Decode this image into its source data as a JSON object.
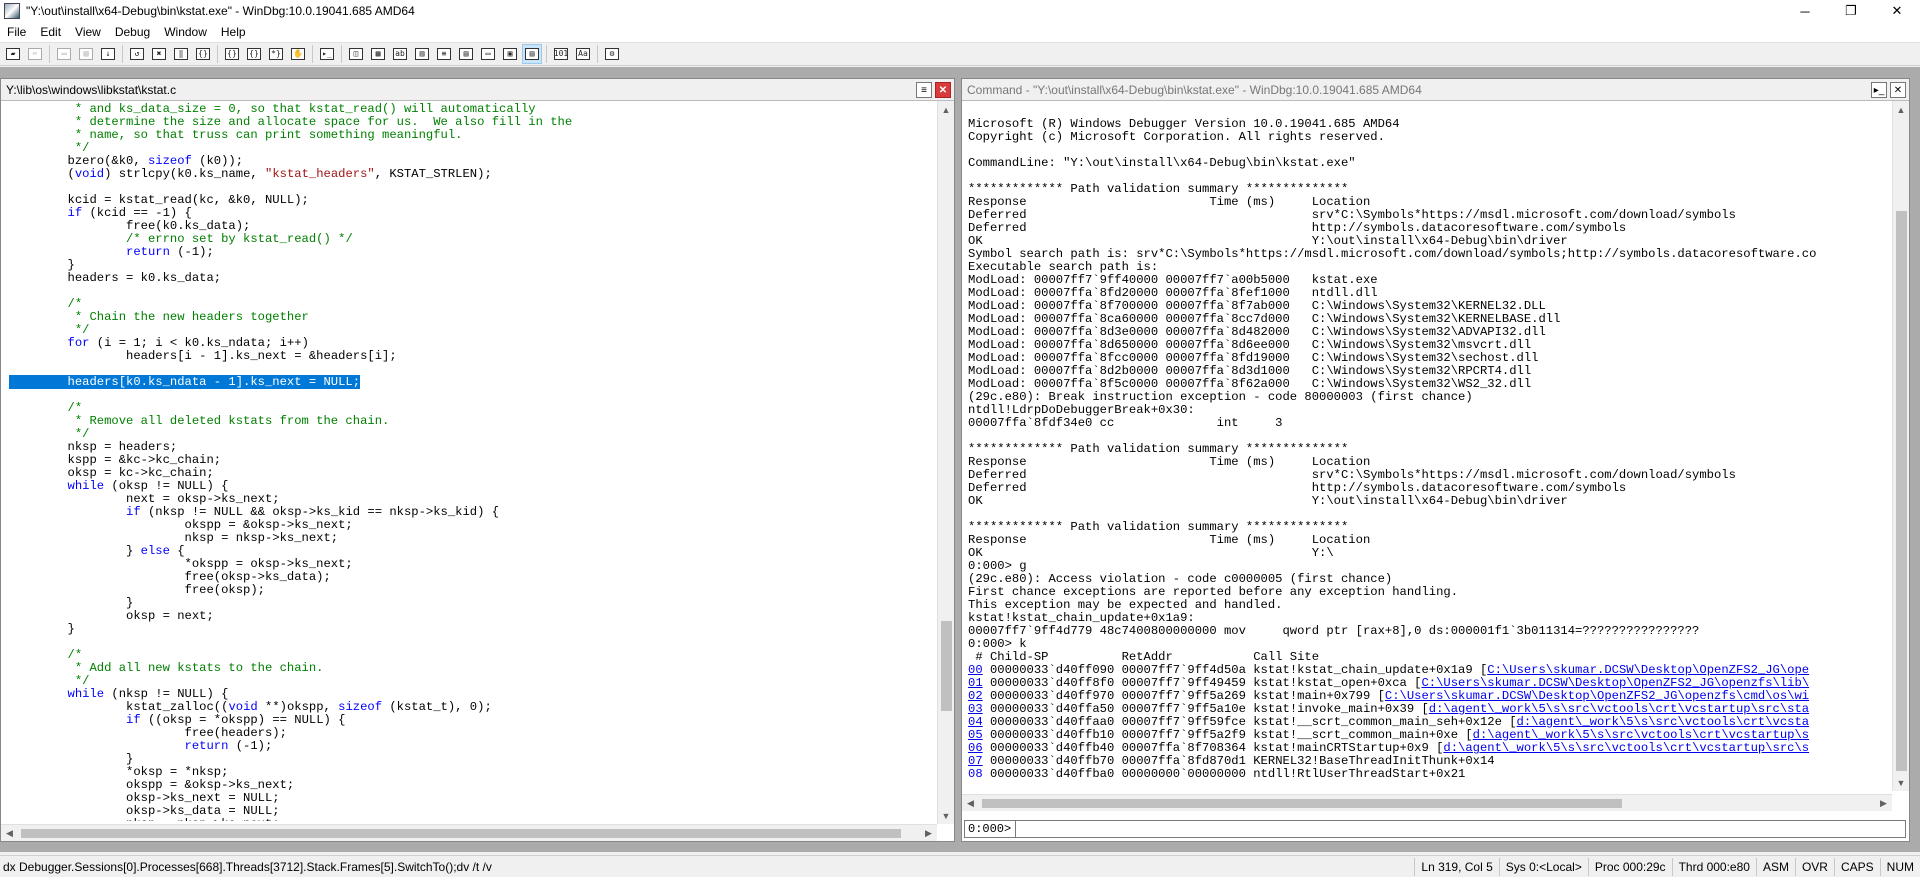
{
  "window": {
    "title": "\"Y:\\out\\install\\x64-Debug\\bin\\kstat.exe\" - WinDbg:10.0.19041.685 AMD64",
    "minimize_glyph": "─",
    "maximize_glyph": "❐",
    "close_glyph": "✕"
  },
  "menu": [
    "File",
    "Edit",
    "View",
    "Debug",
    "Window",
    "Help"
  ],
  "toolbar": [
    {
      "icon": "open-folder-icon",
      "glyph": "▰",
      "enabled": true
    },
    {
      "icon": "cut-icon",
      "glyph": "✂",
      "enabled": false
    },
    {
      "icon": "copy-icon",
      "glyph": "▭",
      "enabled": false
    },
    {
      "icon": "paste-icon",
      "glyph": "▤",
      "enabled": false
    },
    {
      "icon": "go-icon",
      "glyph": "↓",
      "enabled": true
    },
    {
      "icon": "restart-icon",
      "glyph": "↺",
      "enabled": true
    },
    {
      "icon": "stop-debugging-icon",
      "glyph": "✖",
      "enabled": true
    },
    {
      "icon": "break-icon",
      "glyph": "‖",
      "enabled": true
    },
    {
      "icon": "step-into-icon",
      "glyph": "{}",
      "enabled": true
    },
    {
      "icon": "step-over-icon",
      "glyph": "{}",
      "enabled": true
    },
    {
      "icon": "step-out-icon",
      "glyph": "{}",
      "enabled": true
    },
    {
      "icon": "run-to-cursor-icon",
      "glyph": "*}",
      "enabled": true
    },
    {
      "icon": "insert-breakpoint-icon",
      "glyph": "✋",
      "enabled": true
    },
    {
      "icon": "command-window-icon",
      "glyph": "▸_",
      "enabled": true
    },
    {
      "icon": "watch-window-icon",
      "glyph": "◫",
      "enabled": true
    },
    {
      "icon": "locals-window-icon",
      "glyph": "▦",
      "enabled": true
    },
    {
      "icon": "registers-window-icon",
      "glyph": "ab",
      "enabled": true
    },
    {
      "icon": "memory-window-icon",
      "glyph": "▥",
      "enabled": true
    },
    {
      "icon": "call-stack-window-icon",
      "glyph": "≡",
      "enabled": true
    },
    {
      "icon": "disassembly-window-icon",
      "glyph": "▤",
      "enabled": true
    },
    {
      "icon": "scratch-pad-icon",
      "glyph": "▭",
      "enabled": true
    },
    {
      "icon": "processes-threads-icon",
      "glyph": "▣",
      "enabled": true
    },
    {
      "icon": "source-mode-icon",
      "glyph": "▤",
      "enabled": true,
      "active": true
    },
    {
      "icon": "hex-mode-icon",
      "glyph": "101",
      "enabled": true
    },
    {
      "icon": "font-icon",
      "glyph": "Aa",
      "enabled": true
    },
    {
      "icon": "options-icon",
      "glyph": "⚙",
      "enabled": true
    }
  ],
  "source": {
    "title": "Y:\\lib\\os\\windows\\libkstat\\kstat.c",
    "lines": [
      [
        [
          "c",
          "\t * and ks_data_size = 0, so that kstat_read() will automatically"
        ]
      ],
      [
        [
          "c",
          "\t * determine the size and allocate space for us.  We also fill in the"
        ]
      ],
      [
        [
          "c",
          "\t * name, so that truss can print something meaningful."
        ]
      ],
      [
        [
          "c",
          "\t */"
        ]
      ],
      [
        [
          "t",
          "\tbzero(&k0, "
        ],
        [
          "k",
          "sizeof"
        ],
        [
          "t",
          " (k0));"
        ]
      ],
      [
        [
          "t",
          "\t("
        ],
        [
          "k",
          "void"
        ],
        [
          "t",
          ") strlcpy(k0.ks_name, "
        ],
        [
          "s",
          "\"kstat_headers\""
        ],
        [
          "t",
          ", KSTAT_STRLEN);"
        ]
      ],
      [
        [
          "t",
          ""
        ]
      ],
      [
        [
          "t",
          "\tkcid = kstat_read(kc, &k0, NULL);"
        ]
      ],
      [
        [
          "k",
          "\tif"
        ],
        [
          "t",
          " (kcid == -1) {"
        ]
      ],
      [
        [
          "t",
          "\t\tfree(k0.ks_data);"
        ]
      ],
      [
        [
          "c",
          "\t\t/* errno set by kstat_read() */"
        ]
      ],
      [
        [
          "k",
          "\t\treturn"
        ],
        [
          "t",
          " (-1);"
        ]
      ],
      [
        [
          "t",
          "\t}"
        ]
      ],
      [
        [
          "t",
          "\theaders = k0.ks_data;"
        ]
      ],
      [
        [
          "t",
          ""
        ]
      ],
      [
        [
          "c",
          "\t/*"
        ]
      ],
      [
        [
          "c",
          "\t * Chain the new headers together"
        ]
      ],
      [
        [
          "c",
          "\t */"
        ]
      ],
      [
        [
          "k",
          "\tfor"
        ],
        [
          "t",
          " (i = 1; i < k0.ks_ndata; i++)"
        ]
      ],
      [
        [
          "t",
          "\t\theaders[i - 1].ks_next = &headers[i];"
        ]
      ],
      [
        [
          "t",
          ""
        ]
      ],
      [
        [
          "hl",
          "\theaders[k0.ks_ndata - 1].ks_next = NULL;"
        ]
      ],
      [
        [
          "t",
          ""
        ]
      ],
      [
        [
          "c",
          "\t/*"
        ]
      ],
      [
        [
          "c",
          "\t * Remove all deleted kstats from the chain."
        ]
      ],
      [
        [
          "c",
          "\t */"
        ]
      ],
      [
        [
          "t",
          "\tnksp = headers;"
        ]
      ],
      [
        [
          "t",
          "\tkspp = &kc->kc_chain;"
        ]
      ],
      [
        [
          "t",
          "\toksp = kc->kc_chain;"
        ]
      ],
      [
        [
          "k",
          "\twhile"
        ],
        [
          "t",
          " (oksp != NULL) {"
        ]
      ],
      [
        [
          "t",
          "\t\tnext = oksp->ks_next;"
        ]
      ],
      [
        [
          "k",
          "\t\tif"
        ],
        [
          "t",
          " (nksp != NULL && oksp->ks_kid == nksp->ks_kid) {"
        ]
      ],
      [
        [
          "t",
          "\t\t\tokspp = &oksp->ks_next;"
        ]
      ],
      [
        [
          "t",
          "\t\t\tnksp = nksp->ks_next;"
        ]
      ],
      [
        [
          "t",
          "\t\t} "
        ],
        [
          "k",
          "else"
        ],
        [
          "t",
          " {"
        ]
      ],
      [
        [
          "t",
          "\t\t\t*okspp = oksp->ks_next;"
        ]
      ],
      [
        [
          "t",
          "\t\t\tfree(oksp->ks_data);"
        ]
      ],
      [
        [
          "t",
          "\t\t\tfree(oksp);"
        ]
      ],
      [
        [
          "t",
          "\t\t}"
        ]
      ],
      [
        [
          "t",
          "\t\toksp = next;"
        ]
      ],
      [
        [
          "t",
          "\t}"
        ]
      ],
      [
        [
          "t",
          ""
        ]
      ],
      [
        [
          "c",
          "\t/*"
        ]
      ],
      [
        [
          "c",
          "\t * Add all new kstats to the chain."
        ]
      ],
      [
        [
          "c",
          "\t */"
        ]
      ],
      [
        [
          "k",
          "\twhile"
        ],
        [
          "t",
          " (nksp != NULL) {"
        ]
      ],
      [
        [
          "t",
          "\t\tkstat_zalloc(("
        ],
        [
          "k",
          "void"
        ],
        [
          "t",
          " **)okspp, "
        ],
        [
          "k",
          "sizeof"
        ],
        [
          "t",
          " (kstat_t), 0);"
        ]
      ],
      [
        [
          "k",
          "\t\tif"
        ],
        [
          "t",
          " ((oksp = *okspp) == NULL) {"
        ]
      ],
      [
        [
          "t",
          "\t\t\tfree(headers);"
        ]
      ],
      [
        [
          "k",
          "\t\t\treturn"
        ],
        [
          "t",
          " (-1);"
        ]
      ],
      [
        [
          "t",
          "\t\t}"
        ]
      ],
      [
        [
          "t",
          "\t\t*oksp = *nksp;"
        ]
      ],
      [
        [
          "t",
          "\t\tokspp = &oksp->ks_next;"
        ]
      ],
      [
        [
          "t",
          "\t\toksp->ks_next = NULL;"
        ]
      ],
      [
        [
          "t",
          "\t\toksp->ks_data = NULL;"
        ]
      ],
      [
        [
          "t",
          "\t\tnksp = nksp->ks_next;"
        ]
      ],
      [
        [
          "t",
          "\t}"
        ]
      ]
    ]
  },
  "command": {
    "title": "Command - \"Y:\\out\\install\\x64-Debug\\bin\\kstat.exe\" - WinDbg:10.0.19041.685 AMD64",
    "prompt": "0:000>",
    "input_value": "",
    "lines": [
      [
        [
          "t",
          ""
        ]
      ],
      [
        [
          "t",
          "Microsoft (R) Windows Debugger Version 10.0.19041.685 AMD64"
        ]
      ],
      [
        [
          "t",
          "Copyright (c) Microsoft Corporation. All rights reserved."
        ]
      ],
      [
        [
          "t",
          ""
        ]
      ],
      [
        [
          "t",
          "CommandLine: \"Y:\\out\\install\\x64-Debug\\bin\\kstat.exe\""
        ]
      ],
      [
        [
          "t",
          ""
        ]
      ],
      [
        [
          "t",
          "************* Path validation summary **************"
        ]
      ],
      [
        [
          "t",
          "Response                         Time (ms)     Location"
        ]
      ],
      [
        [
          "t",
          "Deferred                                       srv*C:\\Symbols*https://msdl.microsoft.com/download/symbols"
        ]
      ],
      [
        [
          "t",
          "Deferred                                       http://symbols.datacoresoftware.com/symbols"
        ]
      ],
      [
        [
          "t",
          "OK                                             Y:\\out\\install\\x64-Debug\\bin\\driver"
        ]
      ],
      [
        [
          "t",
          "Symbol search path is: srv*C:\\Symbols*https://msdl.microsoft.com/download/symbols;http://symbols.datacoresoftware.co"
        ]
      ],
      [
        [
          "t",
          "Executable search path is:"
        ]
      ],
      [
        [
          "t",
          "ModLoad: 00007ff7`9ff40000 00007ff7`a00b5000   kstat.exe"
        ]
      ],
      [
        [
          "t",
          "ModLoad: 00007ffa`8fd20000 00007ffa`8fef1000   ntdll.dll"
        ]
      ],
      [
        [
          "t",
          "ModLoad: 00007ffa`8f700000 00007ffa`8f7ab000   C:\\Windows\\System32\\KERNEL32.DLL"
        ]
      ],
      [
        [
          "t",
          "ModLoad: 00007ffa`8ca60000 00007ffa`8cc7d000   C:\\Windows\\System32\\KERNELBASE.dll"
        ]
      ],
      [
        [
          "t",
          "ModLoad: 00007ffa`8d3e0000 00007ffa`8d482000   C:\\Windows\\System32\\ADVAPI32.dll"
        ]
      ],
      [
        [
          "t",
          "ModLoad: 00007ffa`8d650000 00007ffa`8d6ee000   C:\\Windows\\System32\\msvcrt.dll"
        ]
      ],
      [
        [
          "t",
          "ModLoad: 00007ffa`8fcc0000 00007ffa`8fd19000   C:\\Windows\\System32\\sechost.dll"
        ]
      ],
      [
        [
          "t",
          "ModLoad: 00007ffa`8d2b0000 00007ffa`8d3d1000   C:\\Windows\\System32\\RPCRT4.dll"
        ]
      ],
      [
        [
          "t",
          "ModLoad: 00007ffa`8f5c0000 00007ffa`8f62a000   C:\\Windows\\System32\\WS2_32.dll"
        ]
      ],
      [
        [
          "t",
          "(29c.e80): Break instruction exception - code 80000003 (first chance)"
        ]
      ],
      [
        [
          "t",
          "ntdll!LdrpDoDebuggerBreak+0x30:"
        ]
      ],
      [
        [
          "t",
          "00007ffa`8fdf34e0 cc              int     3"
        ]
      ],
      [
        [
          "t",
          ""
        ]
      ],
      [
        [
          "t",
          "************* Path validation summary **************"
        ]
      ],
      [
        [
          "t",
          "Response                         Time (ms)     Location"
        ]
      ],
      [
        [
          "t",
          "Deferred                                       srv*C:\\Symbols*https://msdl.microsoft.com/download/symbols"
        ]
      ],
      [
        [
          "t",
          "Deferred                                       http://symbols.datacoresoftware.com/symbols"
        ]
      ],
      [
        [
          "t",
          "OK                                             Y:\\out\\install\\x64-Debug\\bin\\driver"
        ]
      ],
      [
        [
          "t",
          ""
        ]
      ],
      [
        [
          "t",
          "************* Path validation summary **************"
        ]
      ],
      [
        [
          "t",
          "Response                         Time (ms)     Location"
        ]
      ],
      [
        [
          "t",
          "OK                                             Y:\\"
        ]
      ],
      [
        [
          "t",
          "0:000> g"
        ]
      ],
      [
        [
          "t",
          "(29c.e80): Access violation - code c0000005 (first chance)"
        ]
      ],
      [
        [
          "t",
          "First chance exceptions are reported before any exception handling."
        ]
      ],
      [
        [
          "t",
          "This exception may be expected and handled."
        ]
      ],
      [
        [
          "t",
          "kstat!kstat_chain_update+0x1a9:"
        ]
      ],
      [
        [
          "t",
          "00007ff7`9ff4d779 48c7400800000000 mov     qword ptr [rax+8],0 ds:000001f1`3b011314=????????????????"
        ]
      ],
      [
        [
          "t",
          "0:000> k"
        ]
      ],
      [
        [
          "t",
          " # Child-SP          RetAddr           Call Site"
        ]
      ],
      [
        [
          "a",
          "00"
        ],
        [
          "t",
          " 00000033`d40ff090 00007ff7`9ff4d50a kstat!kstat_chain_update+0x1a9 ["
        ],
        [
          "a",
          "C:\\Users\\skumar.DCSW\\Desktop\\OpenZFS2_JG\\ope"
        ]
      ],
      [
        [
          "a",
          "01"
        ],
        [
          "t",
          " 00000033`d40ff8f0 00007ff7`9ff49459 kstat!kstat_open+0xca ["
        ],
        [
          "a",
          "C:\\Users\\skumar.DCSW\\Desktop\\OpenZFS2_JG\\openzfs\\lib\\"
        ]
      ],
      [
        [
          "a",
          "02"
        ],
        [
          "t",
          " 00000033`d40ff970 00007ff7`9ff5a269 kstat!main+0x799 ["
        ],
        [
          "a",
          "C:\\Users\\skumar.DCSW\\Desktop\\OpenZFS2_JG\\openzfs\\cmd\\os\\wi"
        ]
      ],
      [
        [
          "a",
          "03"
        ],
        [
          "t",
          " 00000033`d40ffa50 00007ff7`9ff5a10e kstat!invoke_main+0x39 ["
        ],
        [
          "a",
          "d:\\agent\\_work\\5\\s\\src\\vctools\\crt\\vcstartup\\src\\sta"
        ]
      ],
      [
        [
          "a",
          "04"
        ],
        [
          "t",
          " 00000033`d40ffaa0 00007ff7`9ff59fce kstat!__scrt_common_main_seh+0x12e ["
        ],
        [
          "a",
          "d:\\agent\\_work\\5\\s\\src\\vctools\\crt\\vcsta"
        ]
      ],
      [
        [
          "a",
          "05"
        ],
        [
          "t",
          " 00000033`d40ffb10 00007ff7`9ff5a2f9 kstat!__scrt_common_main+0xe ["
        ],
        [
          "a",
          "d:\\agent\\_work\\5\\s\\src\\vctools\\crt\\vcstartup\\s"
        ]
      ],
      [
        [
          "a",
          "06"
        ],
        [
          "t",
          " 00000033`d40ffb40 00007ffa`8f708364 kstat!mainCRTStartup+0x9 ["
        ],
        [
          "a",
          "d:\\agent\\_work\\5\\s\\src\\vctools\\crt\\vcstartup\\src\\s"
        ]
      ],
      [
        [
          "a",
          "07"
        ],
        [
          "t",
          " 00000033`d40ffb70 00007ffa`8fd870d1 KERNEL32!BaseThreadInitThunk+0x14"
        ]
      ],
      [
        [
          "a",
          "08"
        ],
        [
          "t",
          " 00000033`d40ffba0 00000000`00000000 ntdll!RtlUserThreadStart+0x21"
        ]
      ]
    ]
  },
  "status": {
    "expression": "dx Debugger.Sessions[0].Processes[668].Threads[3712].Stack.Frames[5].SwitchTo();dv /t /v",
    "cells": [
      "Ln 319, Col 5",
      "Sys 0:<Local>",
      "Proc 000:29c",
      "Thrd 000:e80",
      "ASM",
      "OVR",
      "CAPS",
      "NUM"
    ]
  }
}
